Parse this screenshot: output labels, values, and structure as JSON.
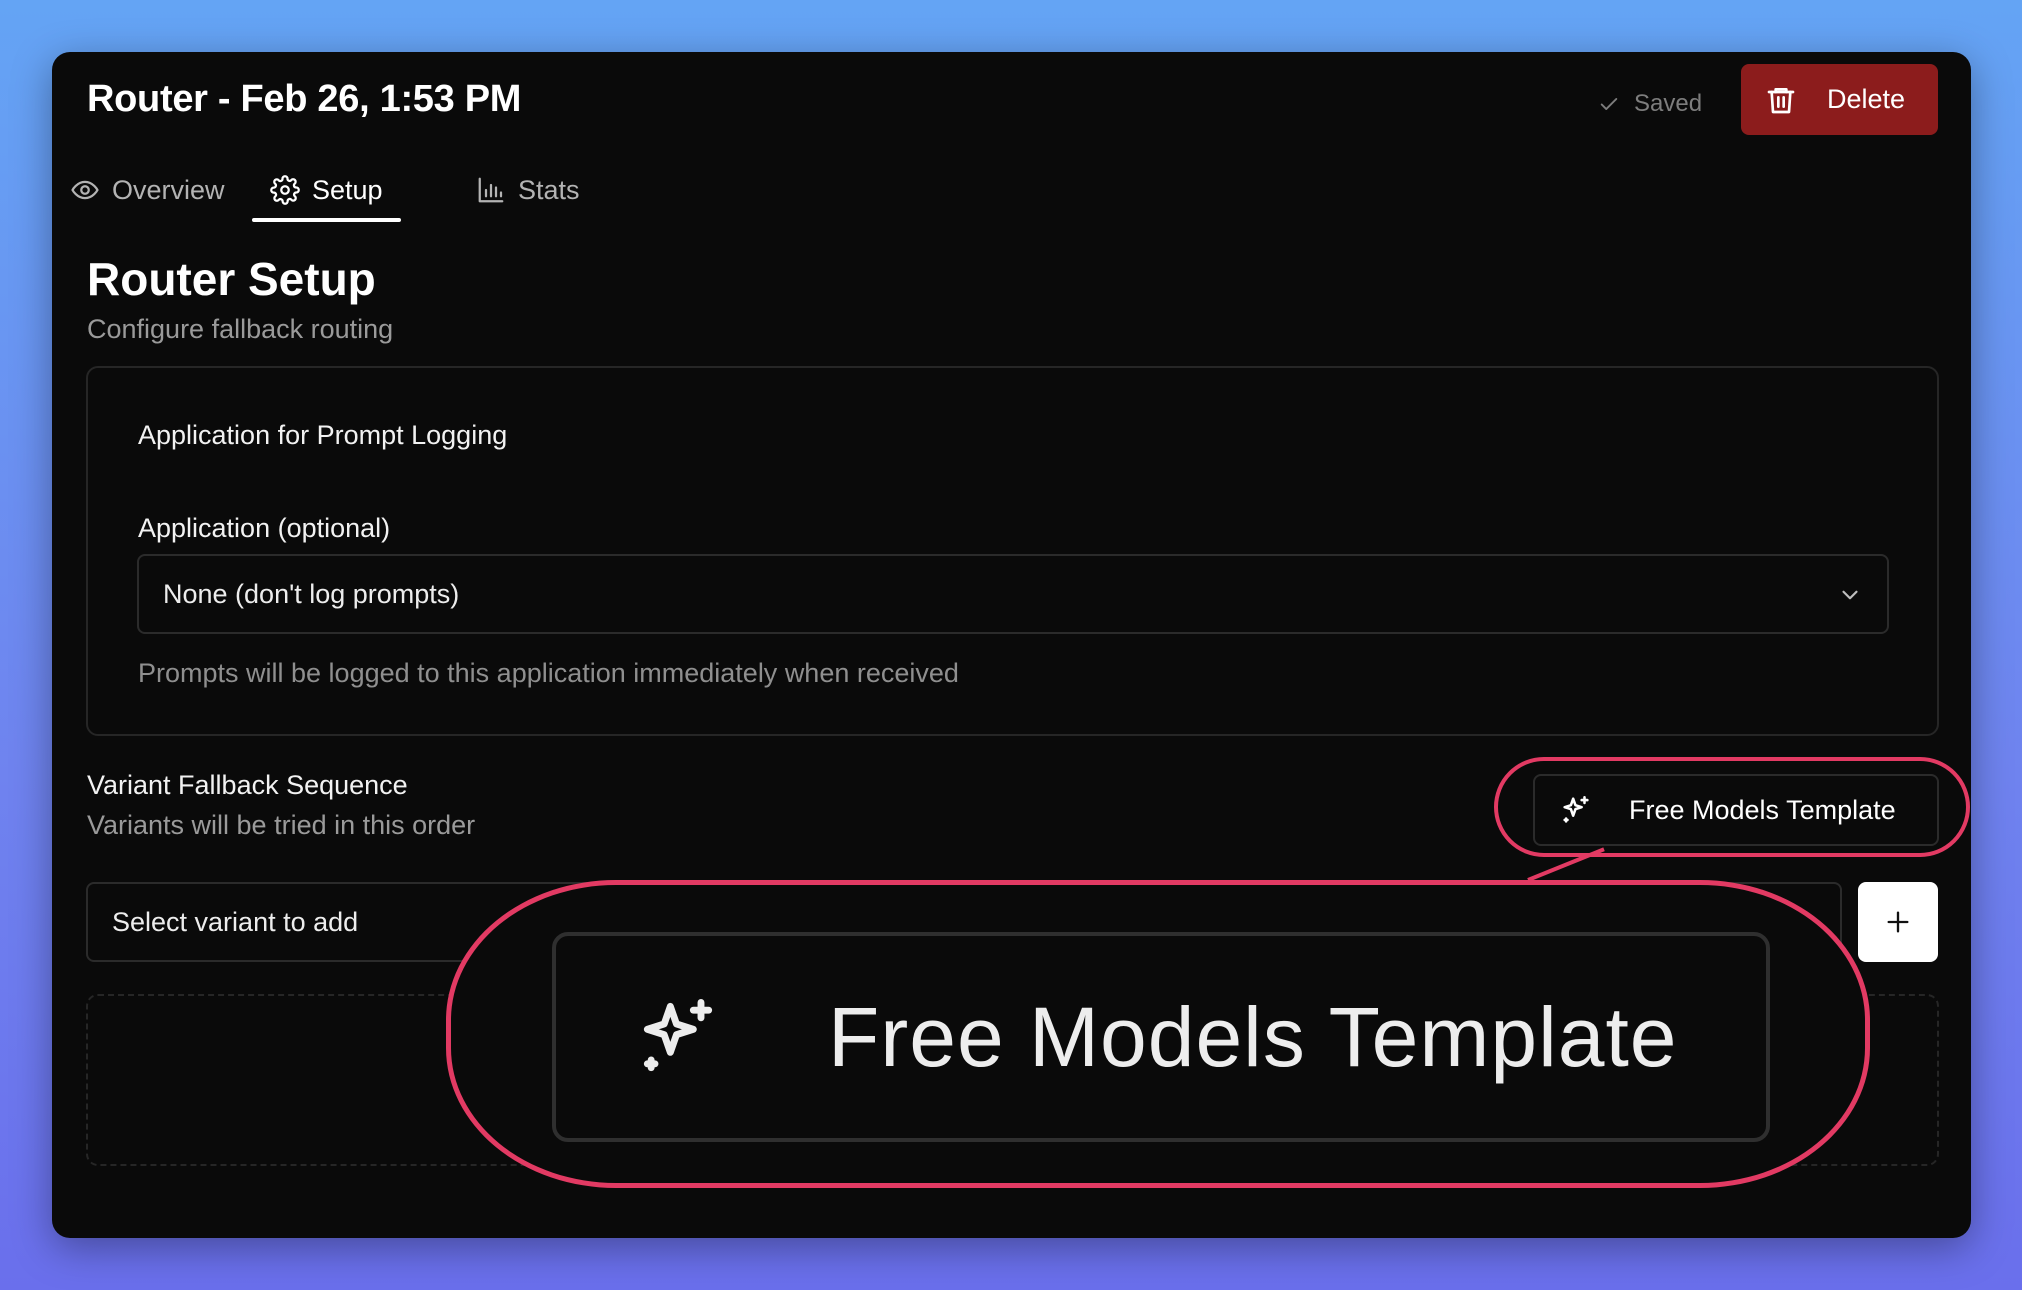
{
  "header": {
    "title": "Router - Feb 26, 1:53 PM",
    "saved_label": "Saved",
    "delete_label": "Delete"
  },
  "tabs": [
    {
      "label": "Overview",
      "icon": "eye-icon",
      "active": false
    },
    {
      "label": "Setup",
      "icon": "gear-icon",
      "active": true
    },
    {
      "label": "Stats",
      "icon": "bar-chart-icon",
      "active": false
    }
  ],
  "page": {
    "title": "Router Setup",
    "subtitle": "Configure fallback routing"
  },
  "logging_card": {
    "title": "Application for Prompt Logging",
    "field_label": "Application (optional)",
    "selected_value": "None (don't log prompts)",
    "helper": "Prompts will be logged to this application immediately when received"
  },
  "fallback": {
    "title": "Variant Fallback Sequence",
    "subtitle": "Variants will be tried in this order",
    "template_button": "Free Models Template",
    "select_placeholder": "Select variant to add",
    "add_icon": "plus-icon"
  },
  "annotation": {
    "zoom_label": "Free Models Template",
    "color": "#e23a63"
  },
  "colors": {
    "background": "#0a0a0a",
    "delete": "#8c1c1c",
    "accent_ring": "#e23a63"
  }
}
